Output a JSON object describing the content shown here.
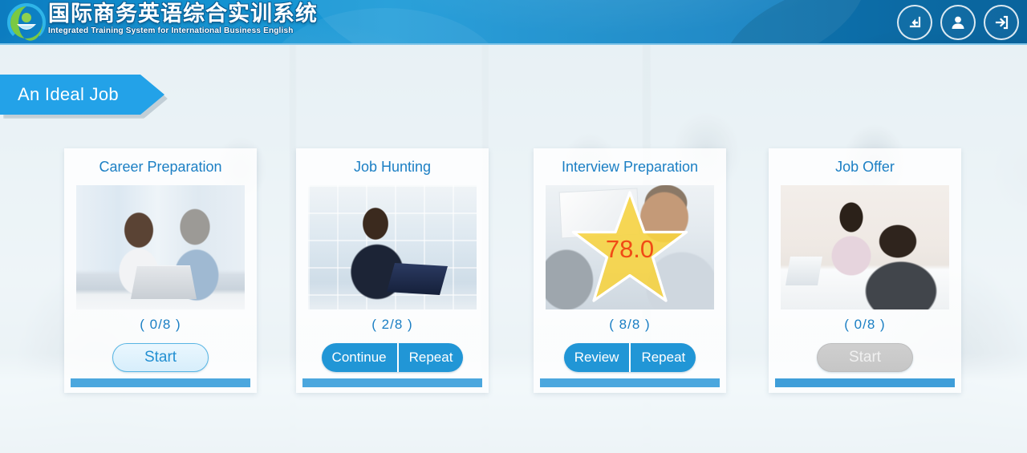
{
  "header": {
    "logo_icon": "leaf-bowl-logo-icon",
    "brand_cn": "国际商务英语综合实训系统",
    "brand_en": "Integrated Training System for International Business English",
    "actions": [
      {
        "icon": "back-arrow-icon",
        "name": "back-button"
      },
      {
        "icon": "user-profile-icon",
        "name": "user-profile-button"
      },
      {
        "icon": "logout-exit-icon",
        "name": "logout-button"
      }
    ]
  },
  "ribbon": {
    "label": "An Ideal Job"
  },
  "colors": {
    "header_blue": "#1190cf",
    "ribbon_blue": "#23a2e8",
    "accent_blue": "#2196d6",
    "title_blue": "#1b7fc4",
    "footbar_blue": "#4ba7de",
    "star_yellow": "#f7d33e",
    "score_red": "#f04b16",
    "disabled_gray": "#c9c9c9"
  },
  "cards": [
    {
      "title": "Career Preparation",
      "thumb": "two-men-reviewing-documents-thumb",
      "count": "( 0/8 )",
      "score": null,
      "buttons": [
        {
          "label": "Start",
          "style": "start",
          "disabled": false
        }
      ]
    },
    {
      "title": "Job Hunting",
      "thumb": "woman-at-laptop-thumb",
      "count": "( 2/8 )",
      "score": null,
      "buttons": [
        {
          "label": "Continue",
          "style": "split",
          "disabled": false
        },
        {
          "label": "Repeat",
          "style": "split",
          "disabled": false
        }
      ]
    },
    {
      "title": "Interview Preparation",
      "thumb": "man-reviewing-resume-thumb",
      "count": "( 8/8 )",
      "score": "78.0",
      "buttons": [
        {
          "label": "Review",
          "style": "split",
          "disabled": false
        },
        {
          "label": "Repeat",
          "style": "split",
          "disabled": false
        }
      ]
    },
    {
      "title": "Job Offer",
      "thumb": "interview-across-desk-thumb",
      "count": "( 0/8 )",
      "score": null,
      "buttons": [
        {
          "label": "Start",
          "style": "start",
          "disabled": true
        }
      ]
    }
  ]
}
